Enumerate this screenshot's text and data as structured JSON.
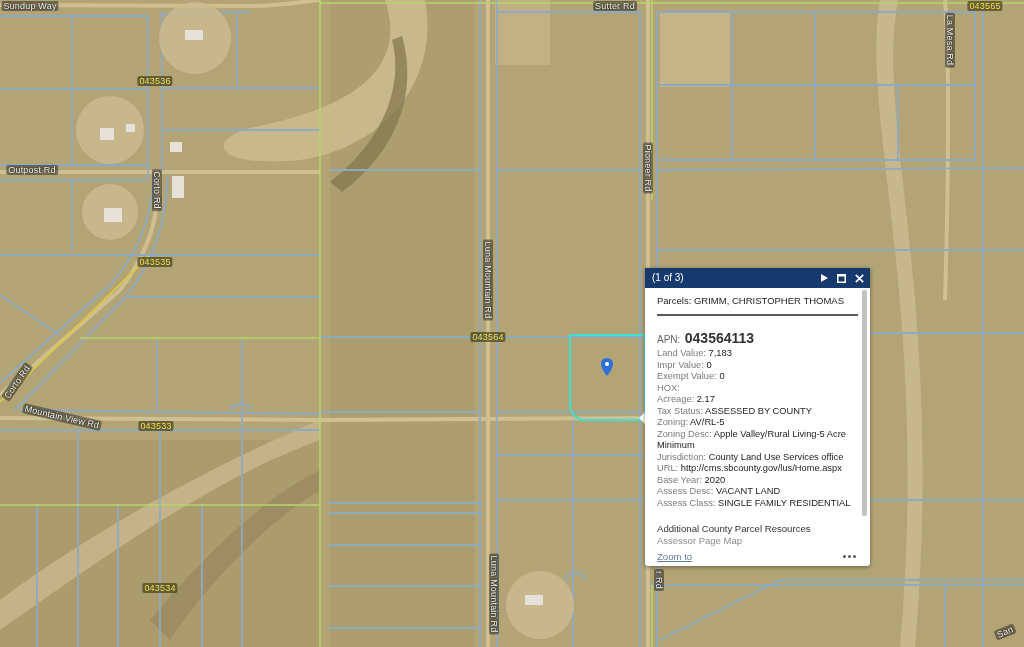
{
  "map": {
    "road_labels": [
      "Sundup Way",
      "Sutter Rd",
      "La Mesa Rd",
      "Outpost Rd",
      "Corto Rd",
      "Pioneer Rd",
      "Luna Mountain Rd",
      "Corto Rd",
      "Mountain View Rd",
      "Luna Mountain Rd",
      "r Rd",
      "San"
    ],
    "parcel_labels": [
      "043565",
      "043536",
      "043535",
      "043564",
      "043533",
      "043534"
    ]
  },
  "popup": {
    "counter": "(1 of 3)",
    "title": "Parcels: GRIMM, CHRISTOPHER THOMAS",
    "apn": {
      "label": "APN:",
      "value": "043564113"
    },
    "fields": [
      {
        "label": "Land Value:",
        "value": "7,183"
      },
      {
        "label": "Impr Value:",
        "value": "0"
      },
      {
        "label": "Exempt Value:",
        "value": "0"
      },
      {
        "label": "HOX:"
      },
      {
        "label": "Acreage:",
        "value": "2.17"
      },
      {
        "label": "Tax Status:",
        "value": "ASSESSED BY COUNTY"
      },
      {
        "label": "Zoning:",
        "value": "AV/RL-5"
      },
      {
        "label": "Zoning Desc:",
        "value": "Apple Valley/Rural Living-5 Acre Minimum"
      },
      {
        "label": "Jurisdiction:",
        "value": "County Land Use Services office"
      },
      {
        "label": "URL:",
        "value": "http://cms.sbcounty.gov/lus/Home.aspx"
      },
      {
        "label": "Base Year:",
        "value": "2020"
      },
      {
        "label": "Assess Desc:",
        "value": "VACANT LAND"
      },
      {
        "label": "Assess Class:",
        "value": "SINGLE FAMILY RESIDENTIAL"
      }
    ],
    "section_title": "Additional County Parcel Resources",
    "links": [
      "Assessor Page Map"
    ],
    "footer_link": "Zoom to"
  }
}
